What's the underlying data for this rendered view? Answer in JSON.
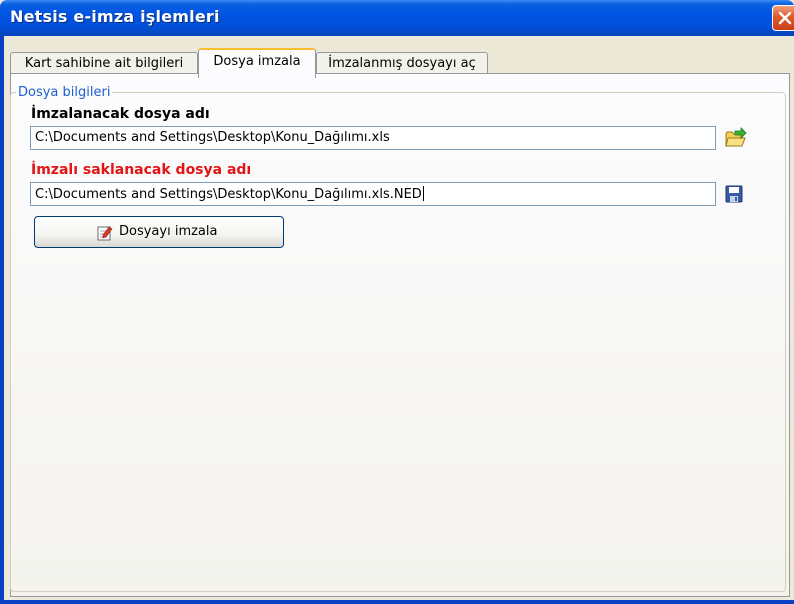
{
  "window": {
    "title": "Netsis e-imza işlemleri"
  },
  "tabs": [
    {
      "label": "Kart sahibine ait bilgileri",
      "active": false
    },
    {
      "label": "Dosya imzala",
      "active": true
    },
    {
      "label": "İmzalanmış dosyayı aç",
      "active": false
    }
  ],
  "group": {
    "legend": "Dosya bilgileri",
    "source_label": "İmzalanacak dosya adı",
    "source_value": "C:\\Documents and Settings\\Desktop\\Konu_Dağılımı.xls",
    "target_label": "İmzalı saklanacak dosya adı",
    "target_value": "C:\\Documents and Settings\\Desktop\\Konu_Dağılımı.xls.NED",
    "sign_button_label": "Dosyayı imzala"
  },
  "colors": {
    "target_label": "#e31414",
    "legend": "#1e5fd6",
    "titlebar": "#0054e3"
  },
  "icons": [
    "close-icon",
    "open-folder-icon",
    "save-disk-icon",
    "sign-document-icon"
  ]
}
